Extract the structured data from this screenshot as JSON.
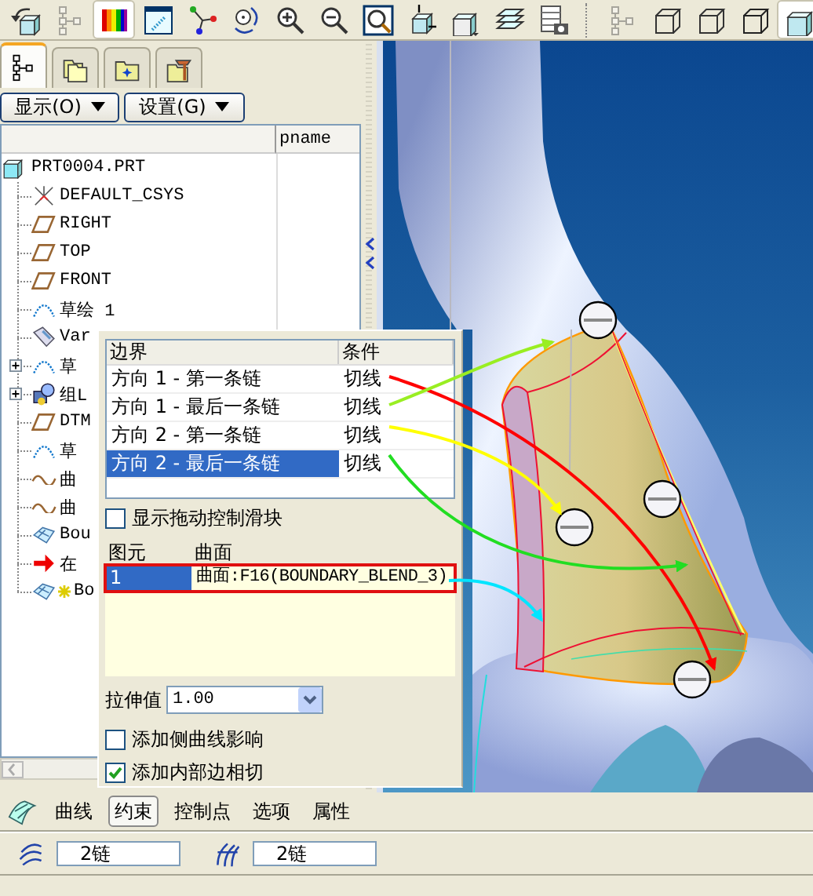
{
  "toolbar": {
    "groups": [
      [
        {
          "kind": "cube-arrow",
          "selected": false,
          "disabled": false
        },
        {
          "kind": "tree",
          "selected": false,
          "disabled": true
        },
        {
          "kind": "color-bars",
          "selected": true,
          "disabled": false
        },
        {
          "kind": "window",
          "selected": false,
          "disabled": false
        },
        {
          "kind": "axes",
          "selected": false,
          "disabled": false
        },
        {
          "kind": "rotate",
          "selected": false,
          "disabled": false
        },
        {
          "kind": "zoom-in",
          "selected": false,
          "disabled": false
        },
        {
          "kind": "zoom-out",
          "selected": false,
          "disabled": false
        },
        {
          "kind": "zoom-fit",
          "selected": false,
          "disabled": false
        },
        {
          "kind": "cube-arrows",
          "selected": false,
          "disabled": false
        },
        {
          "kind": "cube-views",
          "selected": false,
          "disabled": false
        },
        {
          "kind": "layers",
          "selected": false,
          "disabled": false
        },
        {
          "kind": "table-camera",
          "selected": false,
          "disabled": false
        }
      ],
      [
        {
          "kind": "tree",
          "selected": false,
          "disabled": true
        },
        {
          "kind": "wireframe",
          "selected": false,
          "disabled": false
        },
        {
          "kind": "hidden-line",
          "selected": false,
          "disabled": false
        },
        {
          "kind": "no-hidden",
          "selected": false,
          "disabled": false
        },
        {
          "kind": "shaded",
          "selected": true,
          "disabled": false
        }
      ]
    ]
  },
  "navigator_tabs": [
    {
      "kind": "model-tree",
      "selected": true
    },
    {
      "kind": "folders",
      "selected": false
    },
    {
      "kind": "favorites",
      "selected": false
    },
    {
      "kind": "tools",
      "selected": false
    }
  ],
  "tree_buttons": [
    {
      "label": "显示(O)"
    },
    {
      "label": "设置(G)"
    }
  ],
  "model_tree": {
    "columns": [
      "pname"
    ],
    "root": {
      "label": "PRT0004.PRT",
      "kind": "part",
      "children": [
        {
          "label": "DEFAULT_CSYS",
          "kind": "csys",
          "collapsed": false,
          "in_progress": false
        },
        {
          "label": "RIGHT",
          "kind": "plane",
          "collapsed": false,
          "in_progress": false
        },
        {
          "label": "TOP",
          "kind": "plane",
          "collapsed": false,
          "in_progress": false
        },
        {
          "label": "FRONT",
          "kind": "plane",
          "collapsed": false,
          "in_progress": false
        },
        {
          "label": "草绘 1",
          "kind": "sketch",
          "collapsed": false,
          "in_progress": false
        },
        {
          "label": "Var",
          "kind": "var",
          "collapsed": false,
          "in_progress": false
        },
        {
          "label": "草",
          "kind": "sketch",
          "collapsed": true,
          "in_progress": false
        },
        {
          "label": "组L",
          "kind": "group",
          "collapsed": true,
          "in_progress": false
        },
        {
          "label": "DTM",
          "kind": "plane",
          "collapsed": false,
          "in_progress": false
        },
        {
          "label": "草",
          "kind": "sketch",
          "collapsed": false,
          "in_progress": false
        },
        {
          "label": "曲",
          "kind": "curve",
          "collapsed": false,
          "in_progress": false
        },
        {
          "label": "曲",
          "kind": "curve",
          "collapsed": false,
          "in_progress": false
        },
        {
          "label": "Bou",
          "kind": "surface",
          "collapsed": false,
          "in_progress": false
        },
        {
          "label": "在",
          "kind": "insert",
          "collapsed": false,
          "in_progress": false
        },
        {
          "label": "Bo",
          "kind": "surface",
          "collapsed": false,
          "in_progress": true
        }
      ]
    }
  },
  "constraints_panel": {
    "boundary_table": {
      "columns": [
        "边界",
        "条件"
      ],
      "rows": [
        {
          "cells": [
            "方向 1 - 第一条链",
            "切线"
          ],
          "selected": false
        },
        {
          "cells": [
            "方向 1 - 最后一条链",
            "切线"
          ],
          "selected": false
        },
        {
          "cells": [
            "方向 2 - 第一条链",
            "切线"
          ],
          "selected": false
        },
        {
          "cells": [
            "方向 2 - 最后一条链",
            "切线"
          ],
          "selected": true
        }
      ]
    },
    "show_drag_handles": {
      "label": "显示拖动控制滑块",
      "checked": false
    },
    "element_table": {
      "columns": [
        "图元",
        "曲面"
      ],
      "rows": [
        {
          "cells": [
            "1",
            "曲面:F16(BOUNDARY_BLEND_3)"
          ],
          "selected": true
        }
      ]
    },
    "stretch": {
      "label": "拉伸值",
      "value": "1.00"
    },
    "options": [
      {
        "label": "添加侧曲线影响",
        "checked": false
      },
      {
        "label": "添加内部边相切",
        "checked": true
      }
    ]
  },
  "annotation_arrows": [
    {
      "color": "#ff0000"
    },
    {
      "color": "#99ee22"
    },
    {
      "color": "#ffff00"
    },
    {
      "color": "#22dd22"
    },
    {
      "color": "#00e5ff"
    }
  ],
  "dashboard_tabs": [
    {
      "label": "曲线",
      "selected": false
    },
    {
      "label": "约束",
      "selected": true
    },
    {
      "label": "控制点",
      "selected": false
    },
    {
      "label": "选项",
      "selected": false
    },
    {
      "label": "属性",
      "selected": false
    }
  ],
  "chain_fields": [
    {
      "value": "2链"
    },
    {
      "value": "2链"
    }
  ]
}
